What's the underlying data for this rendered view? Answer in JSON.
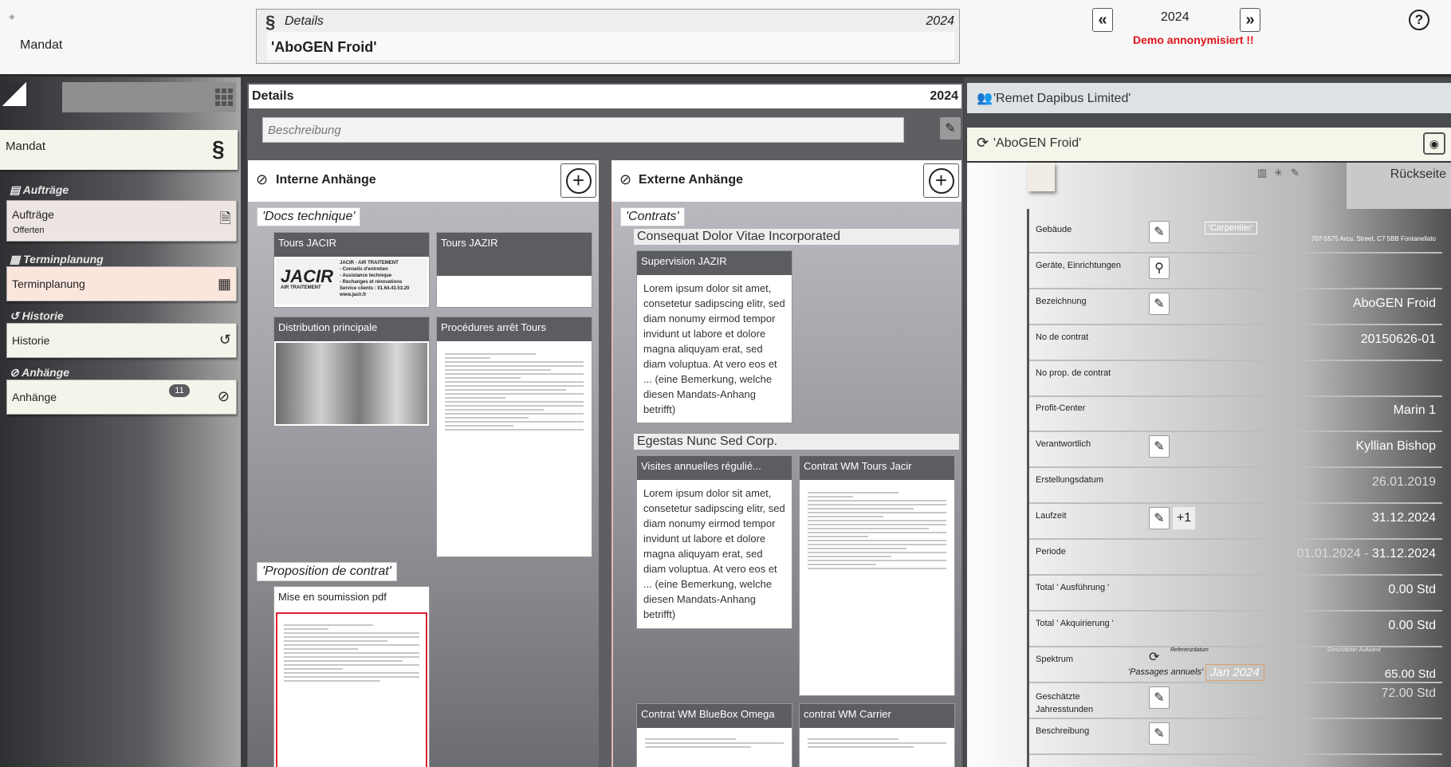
{
  "header": {
    "mandat": "Mandat",
    "section_symbol": "§",
    "details_title": "Details",
    "details_year": "2024",
    "details_value": "'AboGEN Froid'",
    "year": "2024",
    "demo": "Demo annonymisiert !!",
    "prev": "«",
    "next": "»",
    "help": "?"
  },
  "sidebar": {
    "mandat_label": "Mandat",
    "mandat_symbol": "§",
    "sections": [
      {
        "heading": "Aufträge",
        "item": "Aufträge",
        "sub": "Offerten",
        "icon": "document-icon"
      },
      {
        "heading": "Terminplanung",
        "item": "Terminplanung",
        "icon": "calendar-icon"
      },
      {
        "heading": "Historie",
        "item": "Historie",
        "icon": "history-icon"
      },
      {
        "heading": "Anhänge",
        "item": "Anhänge",
        "badge": "11",
        "icon": "paperclip-icon"
      }
    ]
  },
  "details": {
    "title": "Details",
    "year": "2024",
    "desc_placeholder": "Beschreibung"
  },
  "internal": {
    "title": "Interne Anhänge",
    "group1": "'Docs technique'",
    "cards": [
      "Tours JACIR",
      "Tours JAZIR",
      "Distribution principale",
      "Procédures arrêt Tours"
    ],
    "jacir_logo": "JACIR",
    "jacir_sub": "AIR TRAITEMENT",
    "jacir_lines": [
      "JACIR - AIR TRAITEMENT",
      "- Conseils d'entretien",
      "- Assistance technique",
      "- Rechanges et rénovations",
      "Service clients : 01.64.43.53.20",
      "www.jacir.fr"
    ],
    "group2": "'Proposition de contrat'",
    "card5": "Mise en soumission pdf"
  },
  "external": {
    "title": "Externe Anhänge",
    "group": "'Contrats'",
    "company1": "Consequat Dolor Vitae Incorporated",
    "card1": "Supervision JAZIR",
    "lorem": "Lorem ipsum dolor sit amet, consetetur sadipscing elitr, sed diam nonumy eirmod tempor invidunt ut labore et dolore magna aliquyam erat, sed diam voluptua. At vero eos et ... (eine Bemerkung, welche diesen Mandats-Anhang betrifft)",
    "company2": "Egestas Nunc Sed Corp.",
    "card2": "Visites annuelles régulié...",
    "card3": "Contrat WM Tours Jacir",
    "card4": "Contrat WM BlueBox Omega",
    "card5": "contrat WM Carrier"
  },
  "right": {
    "client": "'Remet Dapibus Limited'",
    "mandate": "'AboGEN Froid'",
    "rueckseite": "Rückseite",
    "fields": [
      {
        "label": "Gebäude",
        "value": "",
        "tag": "'Carpentier'",
        "addr": "707-5575 Arcu. Street, C7 5BB Fontanellato"
      },
      {
        "label": "Geräte, Einrichtungen",
        "value": ""
      },
      {
        "label": "Bezeichnung",
        "value": "AboGEN Froid"
      },
      {
        "label": "No de contrat",
        "value": "20150626-01"
      },
      {
        "label": "No prop. de contrat",
        "value": ""
      },
      {
        "label": "Profit-Center",
        "value": "Marin    1"
      },
      {
        "label": "Verantwortlich",
        "value": "Kyllian Bishop"
      },
      {
        "label": "Erstellungsdatum",
        "value": "26.01.2019"
      },
      {
        "label": "Laufzeit",
        "value": "31.12.2024",
        "extra": "+1"
      },
      {
        "label": "Periode",
        "value_a": "01.01.2024",
        "sep": " - ",
        "value": "31.12.2024"
      },
      {
        "label": "Total ' Ausführung '",
        "value": "0.00 Std"
      },
      {
        "label": "Total ' Akquirierung '",
        "value": "0.00 Std"
      },
      {
        "label": "Spektrum",
        "value": "65.00 Std",
        "ref_label": "Referenzdatum",
        "est_label": "Geschätzter Aufwand",
        "spec": "'Passages annuels'",
        "date": "Jan 2024"
      },
      {
        "label": "Geschätzte Jahresstunden",
        "value": "72.00 Std"
      },
      {
        "label": "Beschreibung",
        "value": ""
      }
    ]
  },
  "colors": {
    "demo": "#e0141a",
    "accent": "#5c5d61"
  }
}
